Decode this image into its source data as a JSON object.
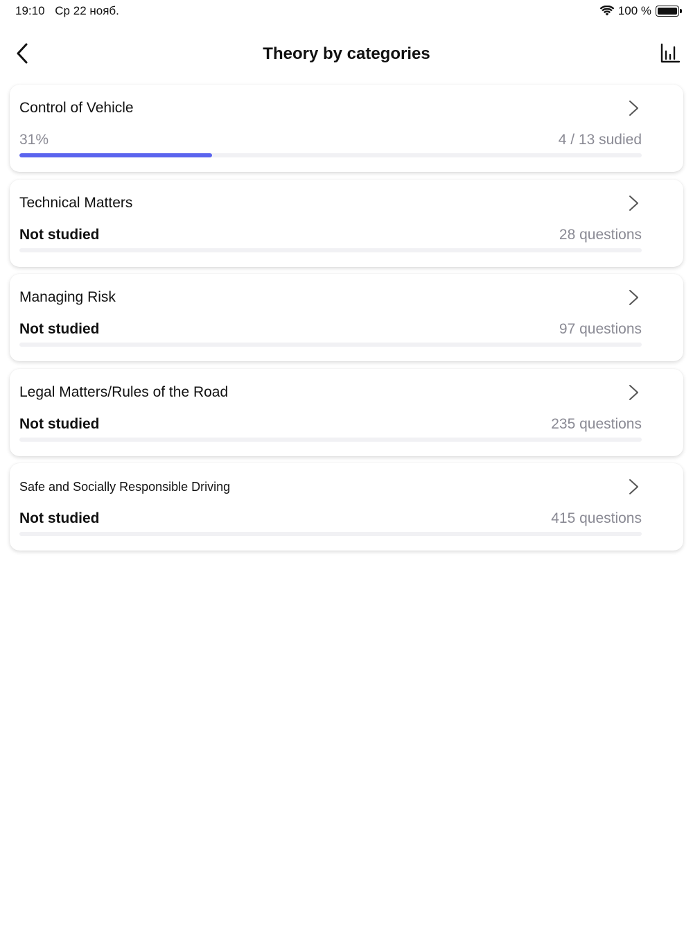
{
  "status_bar": {
    "time": "19:10",
    "date": "Ср 22 нояб.",
    "battery": "100 %"
  },
  "nav": {
    "title": "Theory by categories",
    "back_icon": "chevron-left-icon",
    "stats_icon": "bar-chart-icon"
  },
  "colors": {
    "accent": "#5b64ee",
    "track": "#f1f1f4",
    "muted_text": "#8a8a94"
  },
  "categories": [
    {
      "title": "Control of Vehicle",
      "status": "31%",
      "count": "4 / 13 sudied",
      "progress": 0.31
    },
    {
      "title": "Technical Matters",
      "status": "Not studied",
      "count": "28 questions",
      "progress": 0
    },
    {
      "title": "Managing Risk",
      "status": "Not studied",
      "count": "97 questions",
      "progress": 0
    },
    {
      "title": "Legal Matters/Rules of the Road",
      "status": "Not studied",
      "count": "235 questions",
      "progress": 0
    },
    {
      "title": "Safe and Socially Responsible Driving",
      "status": "Not studied",
      "count": "415 questions",
      "progress": 0
    }
  ]
}
